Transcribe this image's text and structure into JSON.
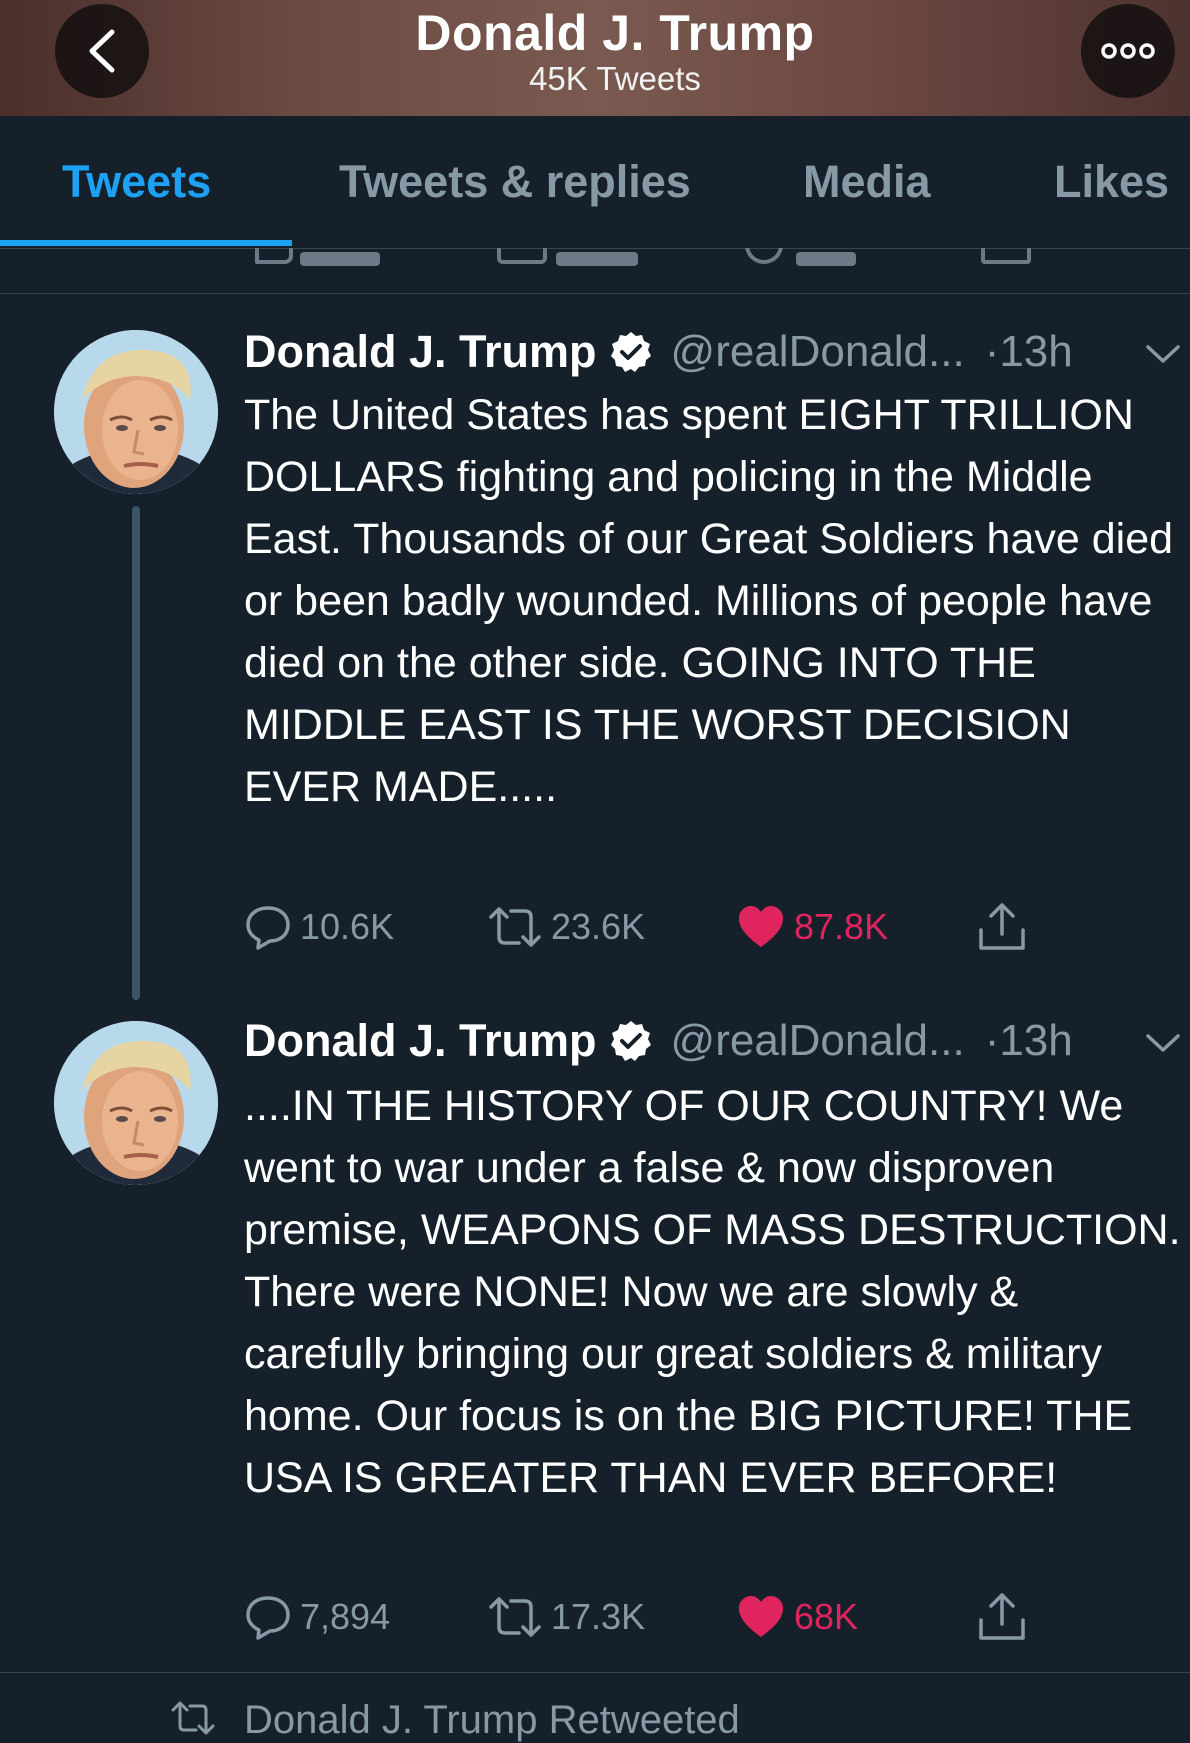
{
  "header": {
    "title": "Donald J. Trump",
    "subtitle": "45K Tweets",
    "back_icon": "chevron-left-icon",
    "more_icon": "more-icon"
  },
  "tabs": [
    {
      "label": "Tweets",
      "active": true
    },
    {
      "label": "Tweets & replies",
      "active": false
    },
    {
      "label": "Media",
      "active": false
    },
    {
      "label": "Likes",
      "active": false
    }
  ],
  "colors": {
    "background": "#15202b",
    "accent": "#1da1f2",
    "muted": "#8899a6",
    "like": "#e0245e",
    "divider": "#38444d"
  },
  "tweets": [
    {
      "name": "Donald J. Trump",
      "handle": "@realDonald...",
      "time": "·13h",
      "text": "The United States has spent EIGHT TRILLION DOLLARS fighting and policing in the Middle East. Thousands of our Great Soldiers have died or been badly wounded. Millions of people have died on the other side. GOING INTO THE MIDDLE EAST IS THE WORST DECISION EVER MADE.....",
      "replies": "10.6K",
      "retweets": "23.6K",
      "likes": "87.8K",
      "liked": true
    },
    {
      "name": "Donald J. Trump",
      "handle": "@realDonald...",
      "time": "·13h",
      "text": "....IN THE HISTORY OF OUR COUNTRY! We went to war under a false & now disproven premise, WEAPONS OF MASS DESTRUCTION. There were NONE! Now we are slowly & carefully bringing our great soldiers & military home. Our focus is on the BIG PICTURE! THE USA IS GREATER THAN EVER BEFORE!",
      "replies": "7,894",
      "retweets": "17.3K",
      "likes": "68K",
      "liked": true
    }
  ],
  "next_item": {
    "retweeted_label": "Donald J. Trump Retweeted"
  }
}
